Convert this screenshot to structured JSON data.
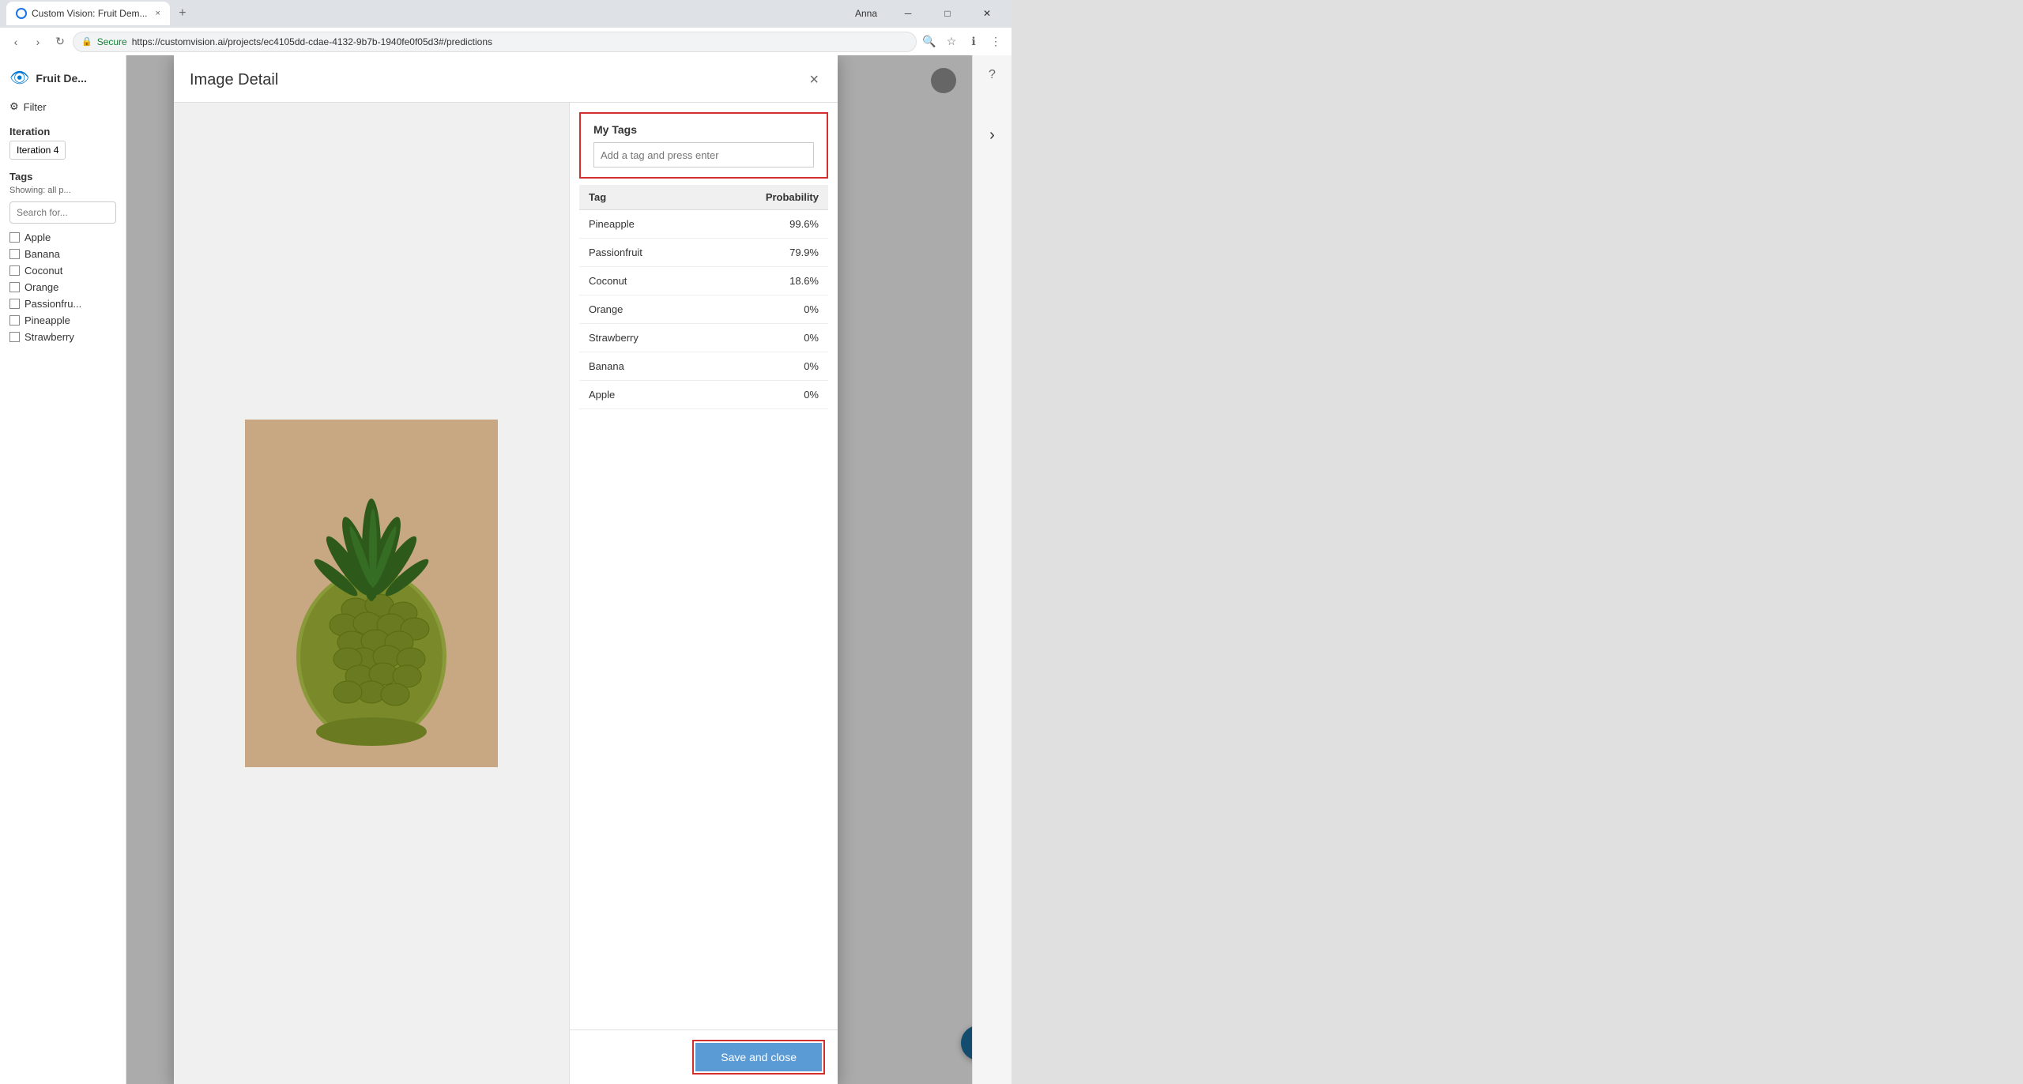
{
  "browser": {
    "tab_title": "Custom Vision: Fruit Dem...",
    "url": "https://customvision.ai/projects/ec4105dd-cdae-4132-9b7b-1940fe0f05d3#/predictions",
    "secure_label": "Secure",
    "user_name": "Anna"
  },
  "sidebar": {
    "app_name": "Fruit De...",
    "filter_label": "Filter",
    "iteration_label": "Iteration",
    "iteration_btn": "Iteration 4",
    "tags_label": "Tags",
    "showing_label": "Showing: all p...",
    "search_placeholder": "Search for...",
    "tags": [
      {
        "name": "Apple"
      },
      {
        "name": "Banana"
      },
      {
        "name": "Coconut"
      },
      {
        "name": "Orange"
      },
      {
        "name": "Passionfru..."
      },
      {
        "name": "Pineapple"
      },
      {
        "name": "Strawberry"
      }
    ]
  },
  "modal": {
    "title": "Image Detail",
    "close_label": "×",
    "my_tags_label": "My Tags",
    "tag_input_placeholder": "Add a tag and press enter",
    "predictions_header_tag": "Tag",
    "predictions_header_prob": "Probability",
    "predictions": [
      {
        "tag": "Pineapple",
        "probability": "99.6%"
      },
      {
        "tag": "Passionfruit",
        "probability": "79.9%"
      },
      {
        "tag": "Coconut",
        "probability": "18.6%"
      },
      {
        "tag": "Orange",
        "probability": "0%"
      },
      {
        "tag": "Strawberry",
        "probability": "0%"
      },
      {
        "tag": "Banana",
        "probability": "0%"
      },
      {
        "tag": "Apple",
        "probability": "0%"
      }
    ],
    "save_close_label": "Save and close"
  },
  "help_btn": "?",
  "right_edge_arrow": "›"
}
